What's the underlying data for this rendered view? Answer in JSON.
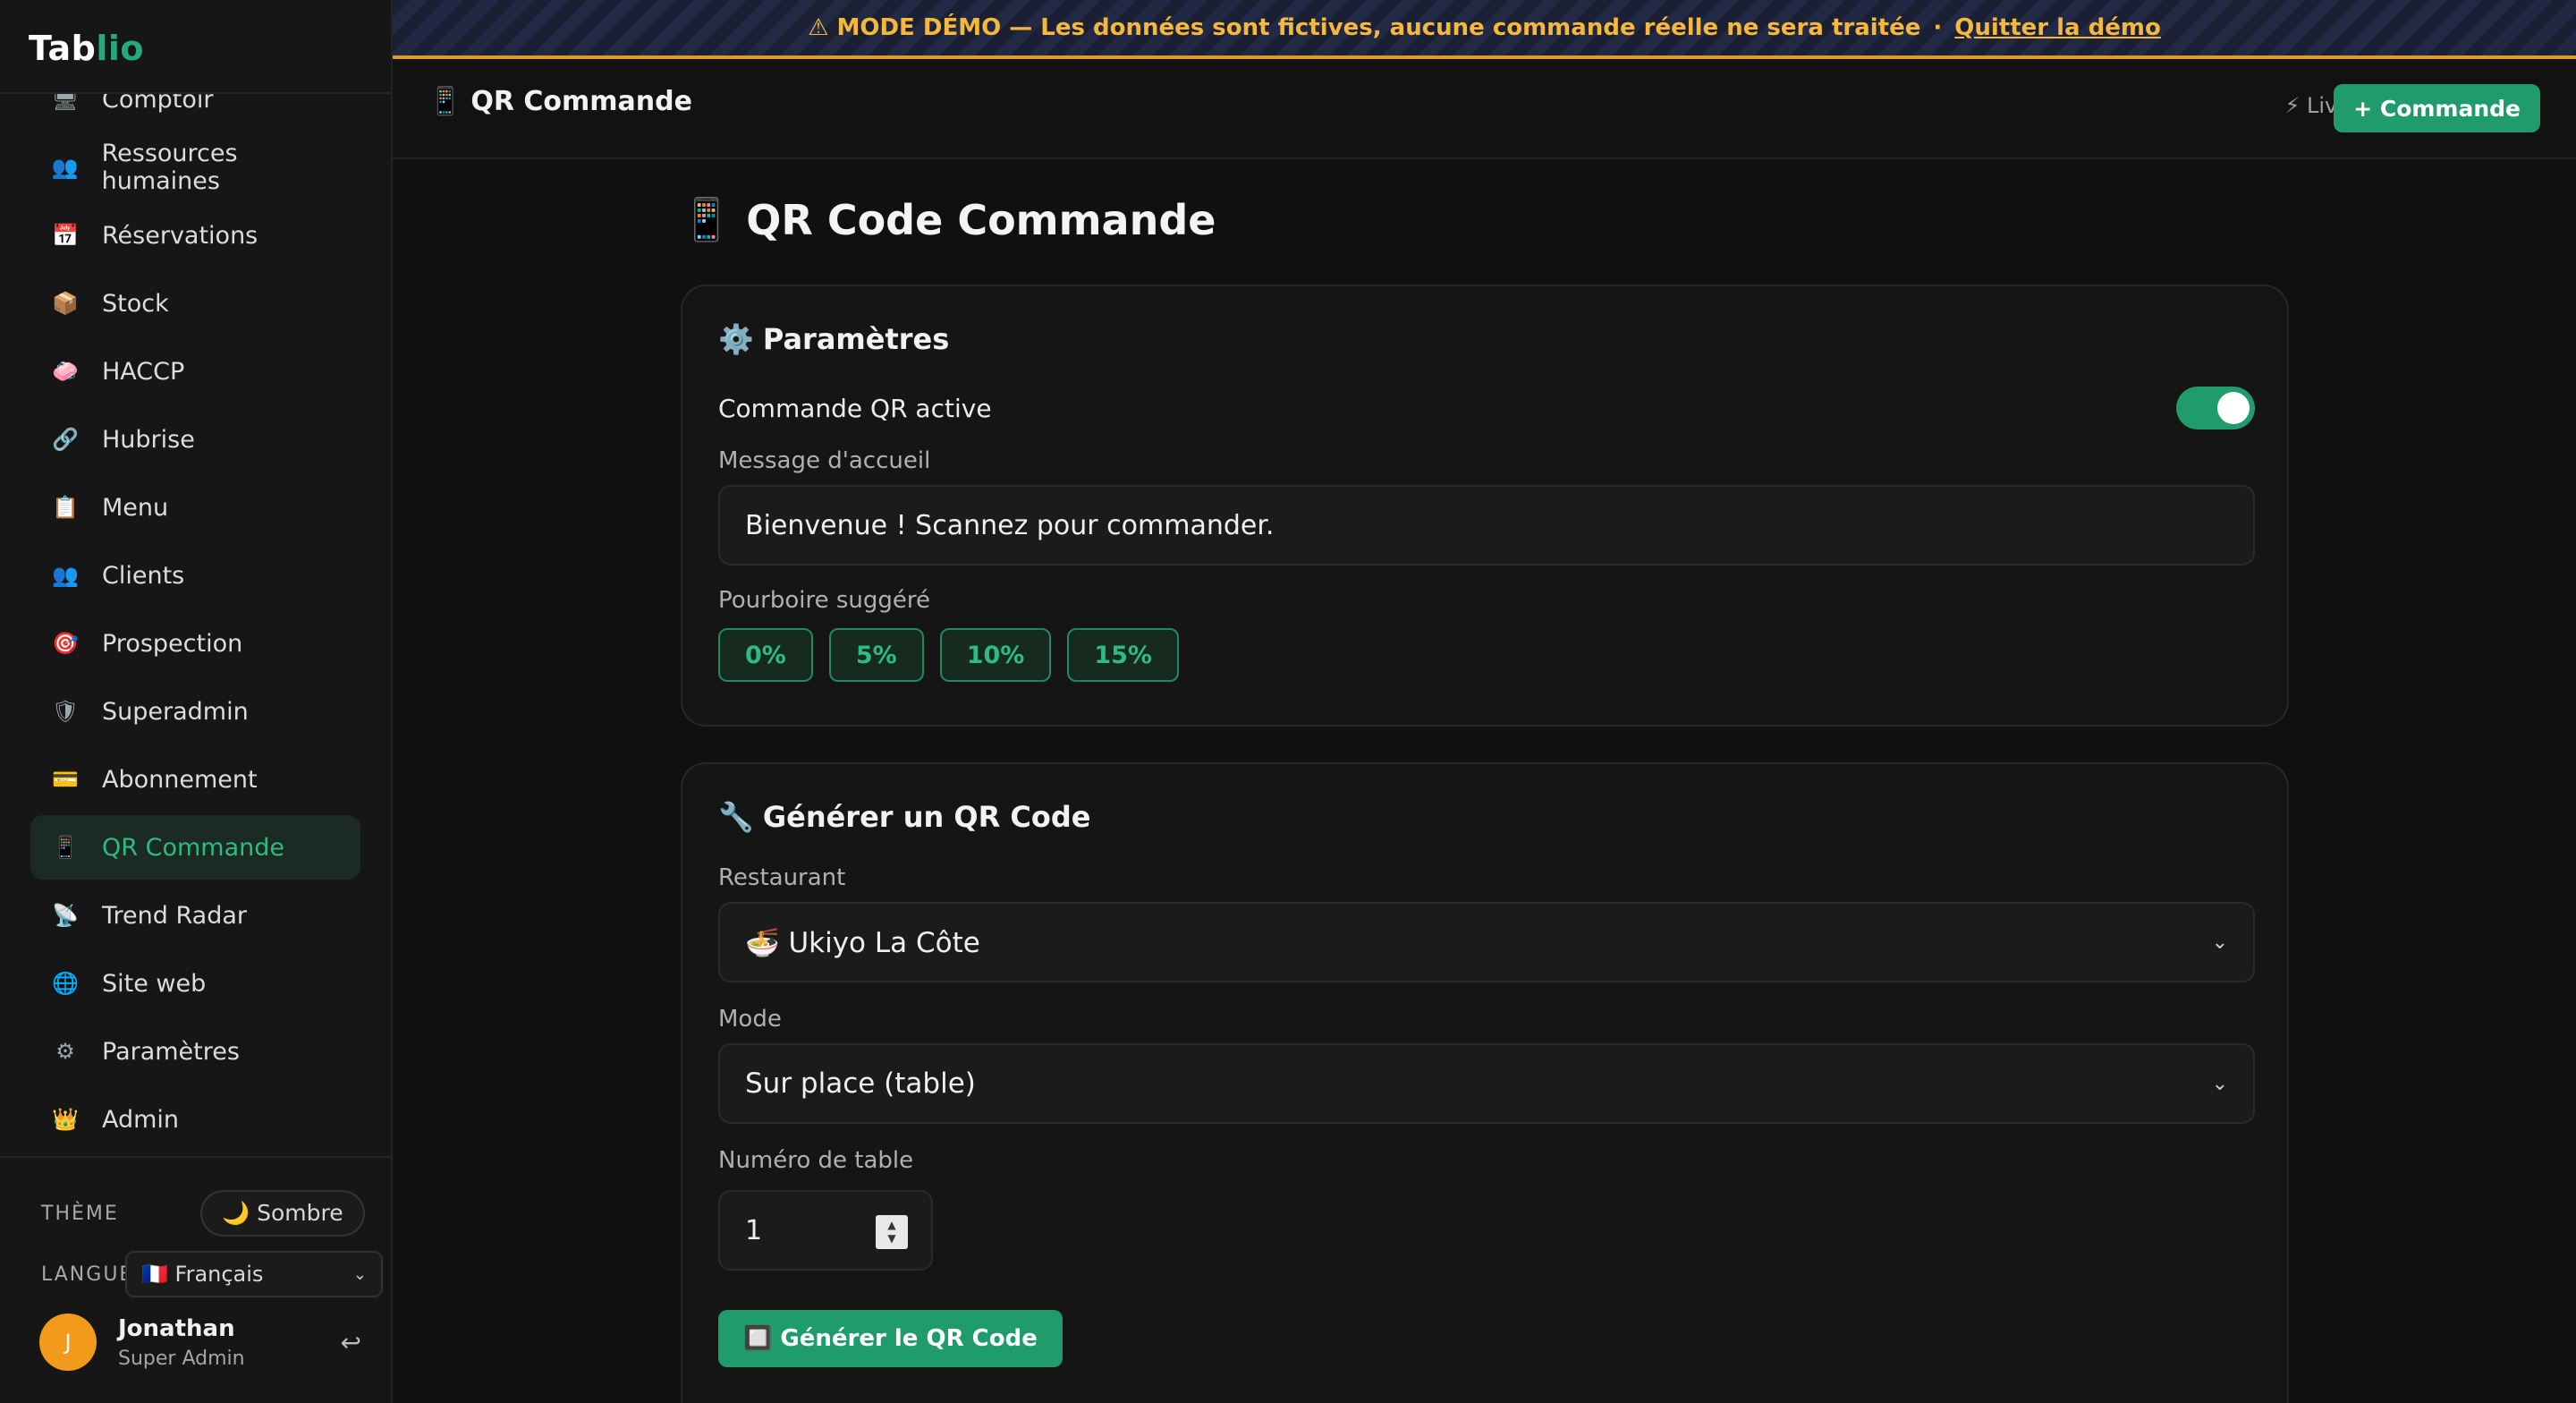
{
  "app": {
    "logo_part1": "Tab",
    "logo_part2": "lio"
  },
  "demo_banner": {
    "icon": "warning-icon",
    "text": "⚠ MODE DÉMO — Les données sont fictives, aucune commande réelle ne sera traitée",
    "separator": "·",
    "quit_label": "Quitter la démo"
  },
  "sidebar": {
    "items": [
      {
        "icon": "🖥",
        "label": "Comptoir"
      },
      {
        "icon": "👥",
        "label": "Ressources humaines"
      },
      {
        "icon": "📅",
        "label": "Réservations"
      },
      {
        "icon": "📦",
        "label": "Stock"
      },
      {
        "icon": "🧼",
        "label": "HACCP"
      },
      {
        "icon": "🔗",
        "label": "Hubrise"
      },
      {
        "icon": "📋",
        "label": "Menu"
      },
      {
        "icon": "👥",
        "label": "Clients"
      },
      {
        "icon": "🎯",
        "label": "Prospection"
      },
      {
        "icon": "🛡",
        "label": "Superadmin"
      },
      {
        "icon": "💳",
        "label": "Abonnement"
      },
      {
        "icon": "📱",
        "label": "QR Commande"
      },
      {
        "icon": "📡",
        "label": "Trend Radar"
      },
      {
        "icon": "🌐",
        "label": "Site web"
      },
      {
        "icon": "⚙",
        "label": "Paramètres"
      },
      {
        "icon": "👑",
        "label": "Admin"
      }
    ],
    "active_item": "QR Commande",
    "theme_label": "THÈME",
    "theme_value": "🌙 Sombre",
    "language_label": "LANGUE",
    "language_value": "🇫🇷 Français",
    "user": {
      "initial": "J",
      "name": "Jonathan",
      "role": "Super Admin"
    }
  },
  "topbar": {
    "icon": "📱",
    "title": "QR Commande",
    "live_label": "⚡ Live",
    "new_order_label": "+ Commande"
  },
  "main": {
    "heading_icon": "📱",
    "heading": "QR Code Commande",
    "settings_card": {
      "title_icon": "⚙️",
      "title": "Paramètres",
      "toggle_label": "Commande QR active",
      "toggle_on": true,
      "welcome_label": "Message d'accueil",
      "welcome_value": "Bienvenue ! Scannez pour commander.",
      "tip_label": "Pourboire suggéré",
      "tips": [
        "0%",
        "5%",
        "10%",
        "15%"
      ]
    },
    "generate_card": {
      "title_icon": "🔧",
      "title": "Générer un QR Code",
      "restaurant_label": "Restaurant",
      "restaurant_value": "🍜 Ukiyo La Côte",
      "mode_label": "Mode",
      "mode_value": "Sur place (table)",
      "table_label": "Numéro de table",
      "table_value": "1",
      "generate_label": "🔲 Générer le QR Code"
    }
  },
  "colors": {
    "accent": "#1f9b6c",
    "accent_text": "#2cbb87",
    "banner_text": "#f5b83a",
    "avatar": "#f19a1c",
    "background": "#101010"
  }
}
